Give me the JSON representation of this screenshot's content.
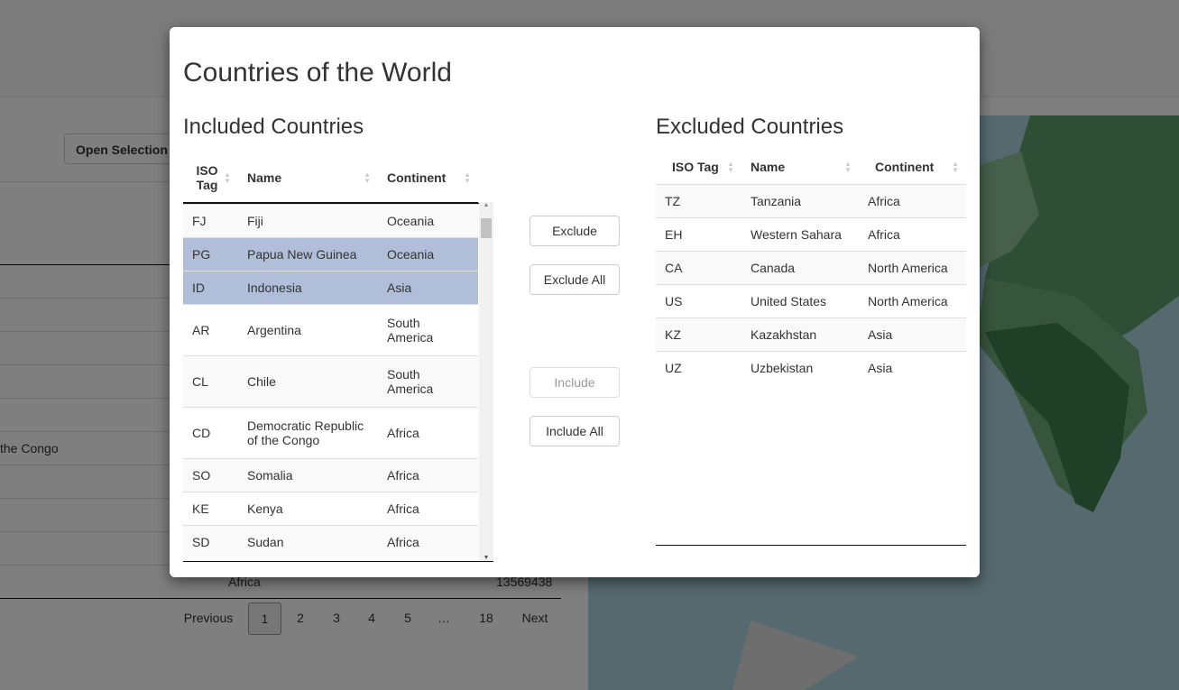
{
  "background": {
    "open_selection": "Open Selection",
    "visible_cell": "the Congo",
    "last_row": {
      "continent": "Africa",
      "value": "13569438"
    },
    "pagination": {
      "previous": "Previous",
      "pages": [
        "1",
        "2",
        "3",
        "4",
        "5",
        "…",
        "18"
      ],
      "next": "Next",
      "current": "1"
    }
  },
  "modal": {
    "title": "Countries of the World",
    "included": {
      "heading": "Included Countries",
      "columns": [
        "ISO Tag",
        "Name",
        "Continent"
      ],
      "rows": [
        {
          "iso": "FJ",
          "name": "Fiji",
          "continent": "Oceania",
          "selected": false
        },
        {
          "iso": "PG",
          "name": "Papua New Guinea",
          "continent": "Oceania",
          "selected": true
        },
        {
          "iso": "ID",
          "name": "Indonesia",
          "continent": "Asia",
          "selected": true
        },
        {
          "iso": "AR",
          "name": "Argentina",
          "continent": "South America",
          "selected": false
        },
        {
          "iso": "CL",
          "name": "Chile",
          "continent": "South America",
          "selected": false
        },
        {
          "iso": "CD",
          "name": "Democratic Republic of the Congo",
          "continent": "Africa",
          "selected": false
        },
        {
          "iso": "SO",
          "name": "Somalia",
          "continent": "Africa",
          "selected": false
        },
        {
          "iso": "KE",
          "name": "Kenya",
          "continent": "Africa",
          "selected": false
        },
        {
          "iso": "SD",
          "name": "Sudan",
          "continent": "Africa",
          "selected": false
        }
      ]
    },
    "buttons": {
      "exclude": "Exclude",
      "exclude_all": "Exclude All",
      "include": "Include",
      "include_all": "Include All"
    },
    "excluded": {
      "heading": "Excluded Countries",
      "columns": [
        "ISO Tag",
        "Name",
        "Continent"
      ],
      "rows": [
        {
          "iso": "TZ",
          "name": "Tanzania",
          "continent": "Africa"
        },
        {
          "iso": "EH",
          "name": "Western Sahara",
          "continent": "Africa"
        },
        {
          "iso": "CA",
          "name": "Canada",
          "continent": "North America"
        },
        {
          "iso": "US",
          "name": "United States",
          "continent": "North America"
        },
        {
          "iso": "KZ",
          "name": "Kazakhstan",
          "continent": "Asia"
        },
        {
          "iso": "UZ",
          "name": "Uzbekistan",
          "continent": "Asia"
        }
      ]
    }
  }
}
